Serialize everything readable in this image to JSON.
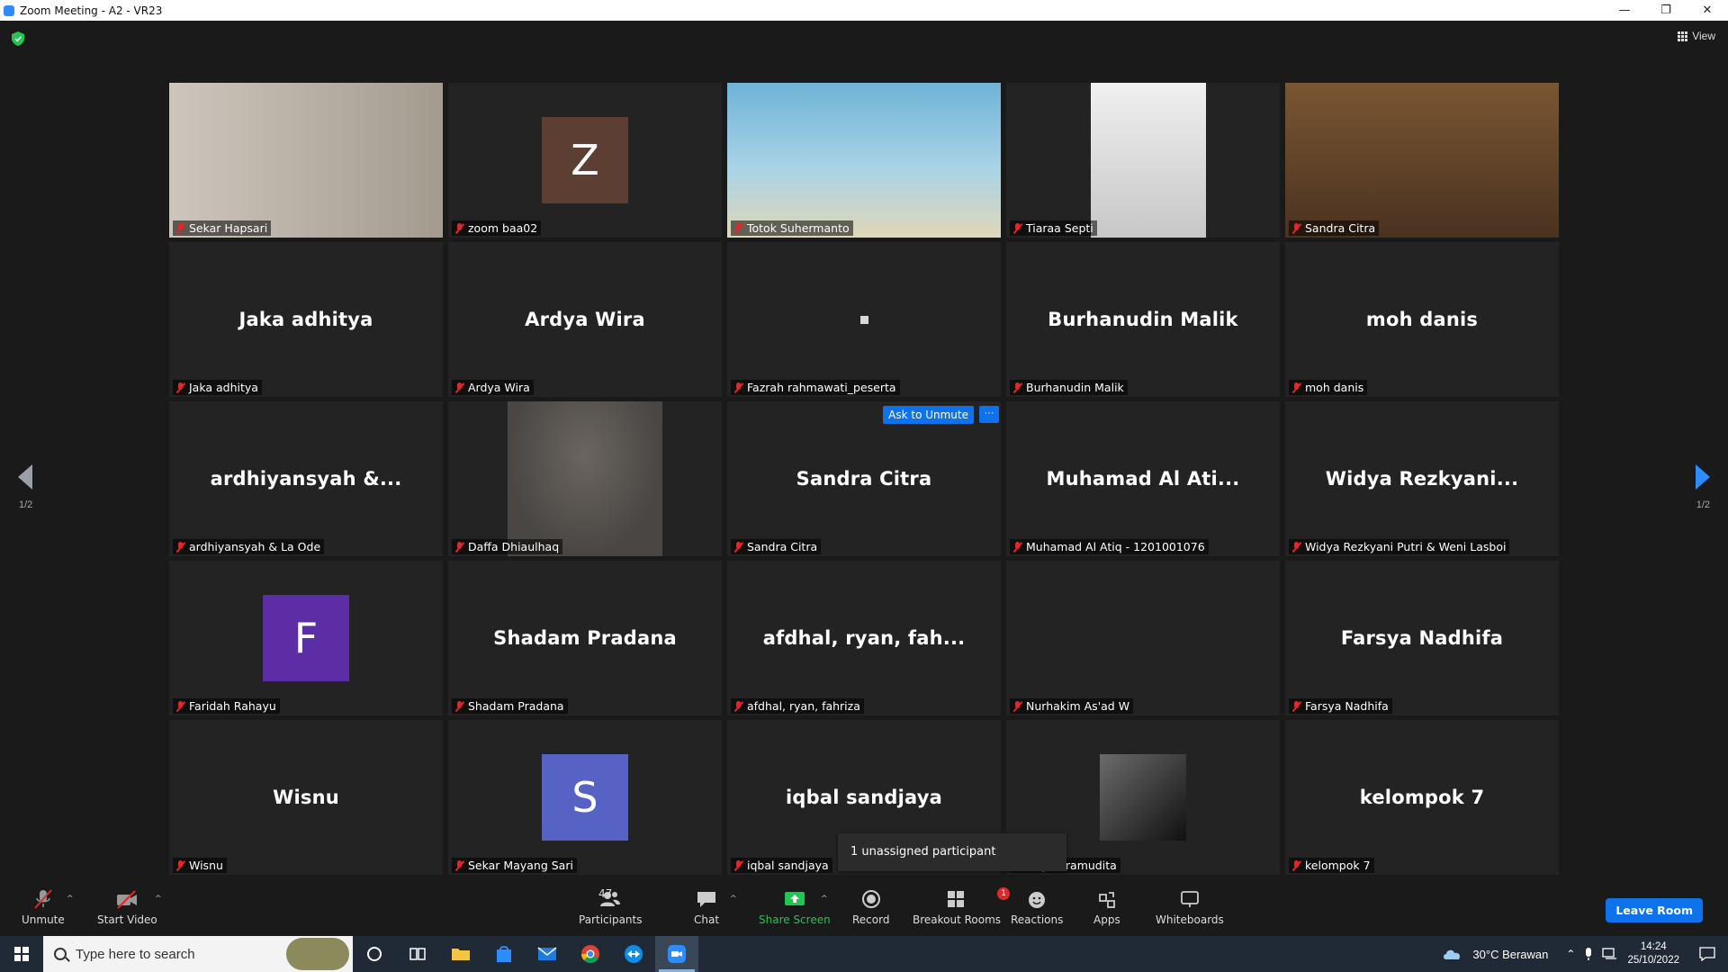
{
  "window": {
    "title": "Zoom Meeting - A2 - VR23",
    "minimize": "—",
    "restore": "❐",
    "close": "✕"
  },
  "meeting": {
    "view_label": "View",
    "page_indicator_left": "1/2",
    "page_indicator_right": "1/2",
    "ask_to_unmute": "Ask to Unmute",
    "more_dots": "···",
    "tooltip": "1 unassigned participant"
  },
  "tiles": [
    {
      "label": "Sekar Hapsari",
      "type": "video",
      "bg": "#b8aea3"
    },
    {
      "label": "zoom baa02",
      "type": "avatar",
      "letter": "Z",
      "color": "#5c3f32"
    },
    {
      "label": "Totok Suhermanto",
      "type": "video",
      "bg": "#5fa6c9",
      "active": true
    },
    {
      "label": "Tiaraa Septi",
      "type": "video",
      "bg": "#d9d9d9"
    },
    {
      "label": "Sandra Citra",
      "type": "video",
      "bg": "#6b4a2a"
    },
    {
      "label": "Jaka adhitya",
      "name": "Jaka adhitya"
    },
    {
      "label": "Ardya Wira",
      "name": "Ardya Wira"
    },
    {
      "label": "Fazrah rahmawati_peserta",
      "type": "dot"
    },
    {
      "label": "Burhanudin Malik",
      "name": "Burhanudin Malik"
    },
    {
      "label": "moh danis",
      "name": "moh danis"
    },
    {
      "label": "ardhiyansyah & La Ode",
      "name": "ardhiyansyah  &..."
    },
    {
      "label": "Daffa Dhiaulhaq",
      "type": "photo",
      "bg": "#55524f"
    },
    {
      "label": "Sandra Citra",
      "name": "Sandra Citra",
      "ask": true
    },
    {
      "label": "Muhamad Al Atiq - 1201001076",
      "name": "Muhamad  Al  Ati..."
    },
    {
      "label": "Widya Rezkyani Putri & Weni Lasboi",
      "name": "Widya  Rezkyani..."
    },
    {
      "label": "Faridah Rahayu",
      "type": "avatar",
      "letter": "F",
      "color": "#5b2ea6"
    },
    {
      "label": "Shadam Pradana",
      "name": "Shadam Pradana"
    },
    {
      "label": "afdhal, ryan, fahriza",
      "name": "afdhal,  ryan,  fah..."
    },
    {
      "label": "Nurhakim As'ad W",
      "name": ""
    },
    {
      "label": "Farsya Nadhifa",
      "name": "Farsya Nadhifa"
    },
    {
      "label": "Wisnu",
      "name": "Wisnu"
    },
    {
      "label": "Sekar Mayang Sari",
      "type": "avatar",
      "letter": "S",
      "color": "#5663c4"
    },
    {
      "label": "iqbal sandjaya",
      "name": "iqbal sandjaya"
    },
    {
      "label": "Dayu Pramudita",
      "type": "photo-small",
      "bg": "#2a2a2a"
    },
    {
      "label": "kelompok 7",
      "name": "kelompok 7"
    }
  ],
  "toolbar": {
    "unmute": "Unmute",
    "start_video": "Start Video",
    "participants": "Participants",
    "participants_count": "47",
    "chat": "Chat",
    "share_screen": "Share Screen",
    "record": "Record",
    "breakout_rooms": "Breakout Rooms",
    "breakout_badge": "1",
    "reactions": "Reactions",
    "apps": "Apps",
    "whiteboards": "Whiteboards",
    "leave": "Leave Room",
    "caret": "^"
  },
  "taskbar": {
    "search_placeholder": "Type here to search",
    "weather": "30°C  Berawan",
    "time": "14:24",
    "date": "25/10/2022"
  },
  "colors": {
    "accent": "#0e72ed",
    "mute_red": "#e02828",
    "share_green": "#23c552",
    "active_border": "#e8e06a"
  }
}
